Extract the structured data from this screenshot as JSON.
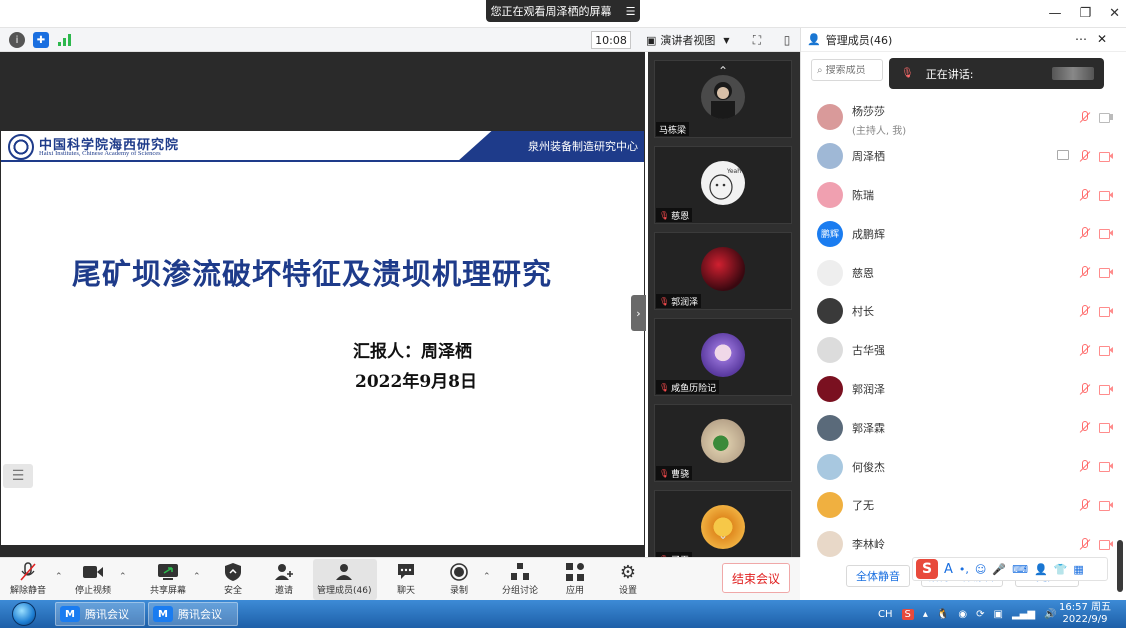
{
  "top": {
    "share_notice": "您正在观看周泽栖的屏幕",
    "menu_icon": "menu-icon",
    "window_icons": [
      "minimize-icon",
      "restore-icon",
      "close-icon"
    ]
  },
  "info_bar": {
    "icons": [
      "info-icon",
      "shield-icon",
      "signal-icon"
    ],
    "time": "10:08",
    "view_mode": "演讲者视图"
  },
  "slide": {
    "org_cn": "中国科学院海西研究院",
    "org_en": "Haixi Institutes, Chinese Academy of Sciences",
    "center": "泉州装备制造研究中心",
    "title": "尾矿坝渗流破坏特征及溃坝机理研究",
    "reporter": "汇报人：周泽栖",
    "date": "2022年9月8日"
  },
  "tiles": [
    {
      "name": "马栋梁",
      "muted": false,
      "avatar_color": "#4a4a4a"
    },
    {
      "name": "慈恩",
      "muted": true,
      "avatar_color": "#f2f2f2"
    },
    {
      "name": "郭润泽",
      "muted": true,
      "avatar_color": "#7a1020"
    },
    {
      "name": "咸鱼历险记",
      "muted": true,
      "avatar_color": "#8e6ad0"
    },
    {
      "name": "曹骁",
      "muted": true,
      "avatar_color": "#b8a48a"
    },
    {
      "name": "了无",
      "muted": true,
      "avatar_color": "#f0b040"
    }
  ],
  "panel": {
    "title": "管理成员(46)",
    "search_placeholder": "搜索成员",
    "speaking_label": "正在讲话:",
    "participants": [
      {
        "name": "杨莎莎",
        "sub": "(主持人, 我)",
        "color": "#d99a9a",
        "initial": "",
        "screen": false,
        "cam_on": true
      },
      {
        "name": "周泽栖",
        "sub": "",
        "color": "#9fb8d6",
        "initial": "",
        "screen": true,
        "cam_on": false
      },
      {
        "name": "陈瑞",
        "sub": "",
        "color": "#f0a0b0",
        "initial": "",
        "screen": false,
        "cam_on": false
      },
      {
        "name": "成鹏辉",
        "sub": "",
        "color": "#1a7cf0",
        "initial": "鹏辉",
        "screen": false,
        "cam_on": false
      },
      {
        "name": "慈恩",
        "sub": "",
        "color": "#eeeeee",
        "initial": "",
        "screen": false,
        "cam_on": false
      },
      {
        "name": "村长",
        "sub": "",
        "color": "#3a3a3a",
        "initial": "",
        "screen": false,
        "cam_on": false
      },
      {
        "name": "古华强",
        "sub": "",
        "color": "#dcdcdc",
        "initial": "",
        "screen": false,
        "cam_on": false
      },
      {
        "name": "郭润泽",
        "sub": "",
        "color": "#7a1020",
        "initial": "",
        "screen": false,
        "cam_on": false
      },
      {
        "name": "郭泽霖",
        "sub": "",
        "color": "#5a6a7a",
        "initial": "",
        "screen": false,
        "cam_on": false
      },
      {
        "name": "何俊杰",
        "sub": "",
        "color": "#a8c8e0",
        "initial": "",
        "screen": false,
        "cam_on": false
      },
      {
        "name": "了无",
        "sub": "",
        "color": "#f0b040",
        "initial": "",
        "screen": false,
        "cam_on": false
      },
      {
        "name": "李林岭",
        "sub": "",
        "color": "#e8d8c8",
        "initial": "",
        "screen": false,
        "cam_on": false
      }
    ],
    "mute_all": "全体静音",
    "remove_all": "解除全体静音",
    "more": "更多"
  },
  "toolbar": {
    "unmute": "解除静音",
    "stop_video": "停止视频",
    "share_screen": "共享屏幕",
    "security": "安全",
    "invite": "邀请",
    "members": "管理成员(46)",
    "chat": "聊天",
    "record": "录制",
    "breakout": "分组讨论",
    "apps": "应用",
    "settings": "设置",
    "end": "结束会议"
  },
  "taskbar": {
    "apps": [
      "腾讯会议",
      "腾讯会议"
    ],
    "lang": "CH",
    "time": "16:57 周五",
    "date": "2022/9/9"
  }
}
